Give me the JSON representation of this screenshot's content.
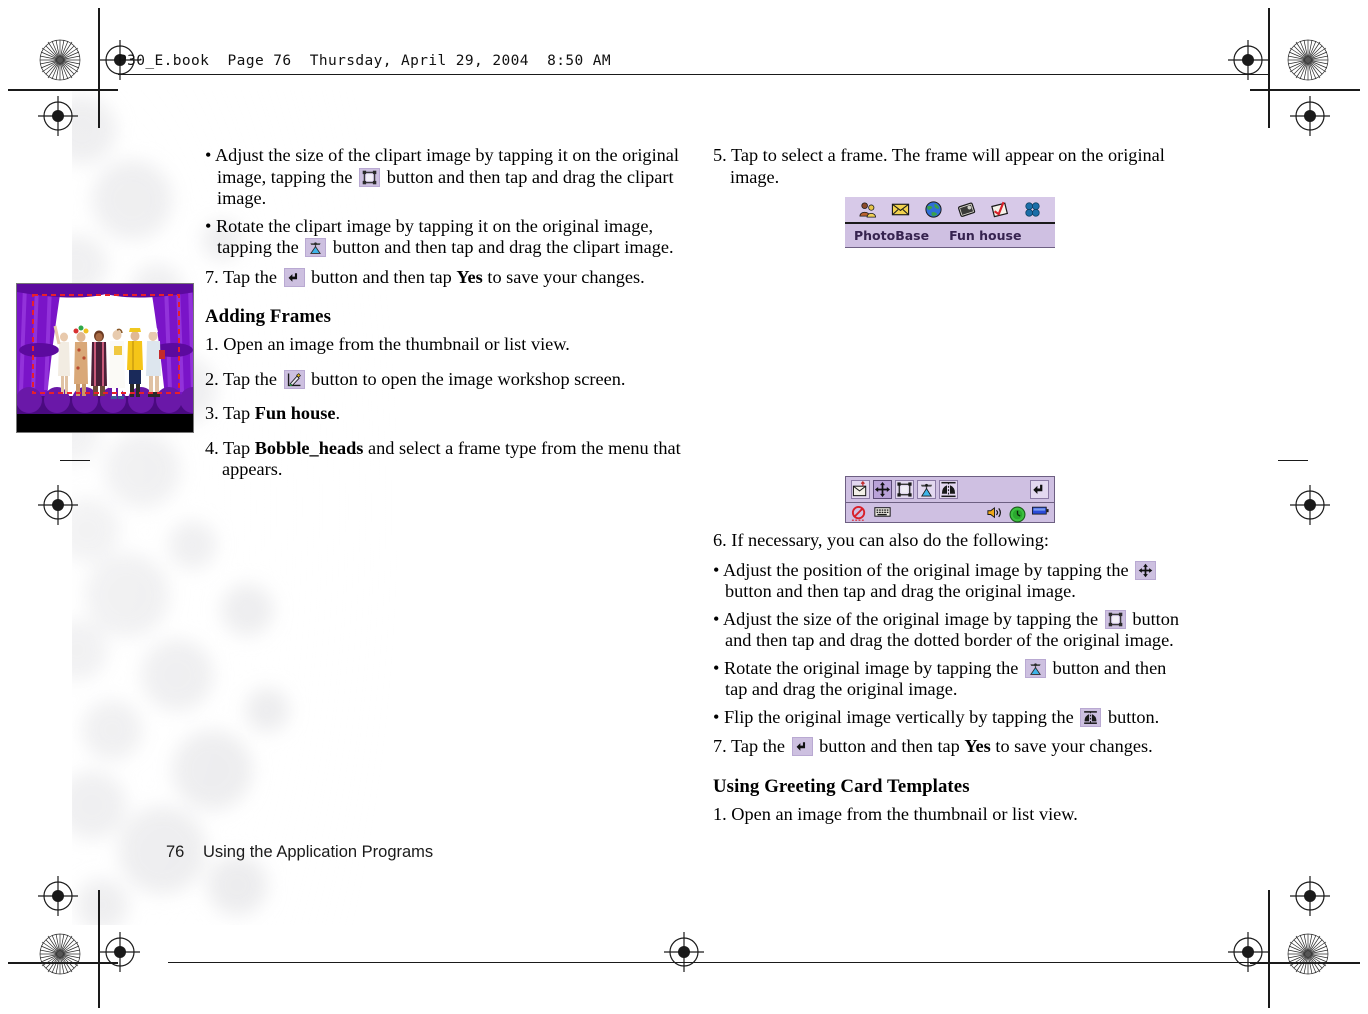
{
  "header": {
    "book_line": "P30_E.book  Page 76  Thursday, April 29, 2004  8:50 AM"
  },
  "footer": {
    "page_number": "76",
    "section_title": "Using the Application Programs"
  },
  "left_column": {
    "bullets": [
      {
        "id": "adjust-size-clipart",
        "before": "• Adjust the size of the clipart image by tapping it on the original image, tapping the",
        "icon": "resize-icon",
        "after": "button and then tap and drag the clipart image."
      },
      {
        "id": "rotate-clipart",
        "before": "• Rotate the clipart image by tapping it on the original image, tapping the",
        "icon": "rotate-icon",
        "after": "button and then tap and drag the clipart image."
      }
    ],
    "step7": {
      "before": "7. Tap the",
      "icon": "back-arrow-icon",
      "mid": "button and then tap",
      "keyword": "Yes",
      "after": "to save your changes."
    },
    "subhead": "Adding Frames",
    "steps": [
      {
        "id": "step-1",
        "text": "1. Open an image from the thumbnail or list view."
      },
      {
        "id": "step-2",
        "before": "2. Tap the",
        "icon": "workshop-icon",
        "after": "button to open the image workshop screen."
      },
      {
        "id": "step-3",
        "before": "3. Tap",
        "keyword": "Fun house",
        "after": "."
      },
      {
        "id": "step-4",
        "before": "4. Tap",
        "keyword": "Bobble_heads",
        "after": "and select a frame type from the menu that appears."
      }
    ]
  },
  "right_column": {
    "step5": "5. Tap to select a frame. The frame will appear on the original image.",
    "step6": "6. If necessary, you can also do the following:",
    "bullets": [
      {
        "id": "adjust-position-original",
        "before": "• Adjust the position of the original image by tapping the",
        "icon": "move-icon",
        "after": "button and then tap and drag the original image."
      },
      {
        "id": "adjust-size-original",
        "before": "• Adjust the size of the original image by tapping the",
        "icon": "resize-icon",
        "after": "button and then tap and drag the dotted border of the original image."
      },
      {
        "id": "rotate-original",
        "before": "• Rotate the original image by tapping the",
        "icon": "rotate-icon",
        "after": "button and then tap and drag the original image."
      },
      {
        "id": "flip-original",
        "before": "• Flip the original image vertically by tapping the",
        "icon": "flip-icon",
        "after": "button."
      }
    ],
    "step7": {
      "before": "7. Tap the",
      "icon": "back-arrow-icon",
      "mid": "button and then tap",
      "keyword": "Yes",
      "after": "to save your changes."
    },
    "subhead": "Using Greeting Card Templates",
    "step1": "1. Open an image from the thumbnail or list view."
  },
  "pda": {
    "toolbar_icons": [
      "contacts-icon",
      "envelope-icon",
      "globe-icon",
      "photo-album-icon",
      "check-note-icon",
      "apps-grid-icon"
    ],
    "menubar": {
      "app_name": "PhotoBase",
      "menu_item": "Fun house"
    },
    "tools": [
      {
        "name": "export-mail-tool",
        "selected": false
      },
      {
        "name": "move-tool",
        "selected": true
      },
      {
        "name": "resize-tool",
        "selected": false
      },
      {
        "name": "rotate-tool",
        "selected": false
      },
      {
        "name": "flip-tool",
        "selected": false
      }
    ],
    "back_button": "back-arrow-icon",
    "status_icons": [
      "no-entry-icon",
      "keyboard-icon",
      "speaker-icon",
      "clock-icon",
      "battery-icon"
    ],
    "canvas": {
      "description": "theatre-curtain-frame-with-people",
      "selection_border_color": "#e8202a",
      "curtain_color": "#7a14c8",
      "stage_color": "#ffffff"
    }
  },
  "colors": {
    "chip_background": "#cdc0e0",
    "pda_toolbar": "#d7c9e8",
    "pda_menubar": "#cfc0e2",
    "menu_text": "#36234f",
    "selected_tool": "#b9a2d8"
  }
}
